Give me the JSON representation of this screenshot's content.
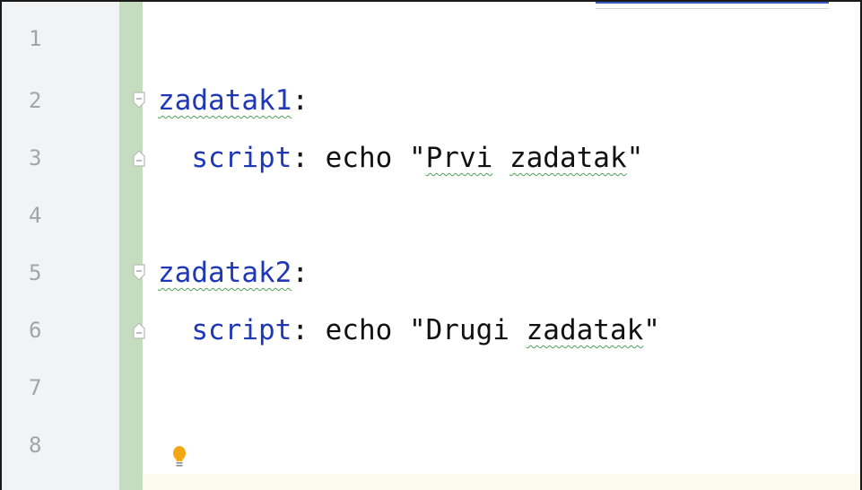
{
  "editor": {
    "line_numbers": [
      "1",
      "2",
      "3",
      "4",
      "5",
      "6",
      "7",
      "8"
    ],
    "lines": {
      "l2": {
        "key": "zadatak1",
        "colon": ":"
      },
      "l3": {
        "indent": "  ",
        "key": "script",
        "colon": ":",
        "cmd": " echo ",
        "q1": "\"",
        "w1": "Prvi",
        "sp": " ",
        "w2": "zadatak",
        "q2": "\""
      },
      "l5": {
        "key": "zadatak2",
        "colon": ":"
      },
      "l6": {
        "indent": "  ",
        "key": "script",
        "colon": ":",
        "cmd": " echo ",
        "q1": "\"",
        "w1": "Drugi",
        "sp": " ",
        "w2": "zadatak",
        "q2": "\""
      }
    },
    "icons": {
      "fold_open": "fold-open-icon",
      "fold_end": "fold-end-icon",
      "intention": "lightbulb-icon"
    },
    "colors": {
      "key": "#1f38b8",
      "gutter_bg": "#f2f3f5",
      "vcs_added": "#c5dcbf",
      "caret_row": "#fdfaee",
      "bulb": "#f3a813"
    }
  }
}
